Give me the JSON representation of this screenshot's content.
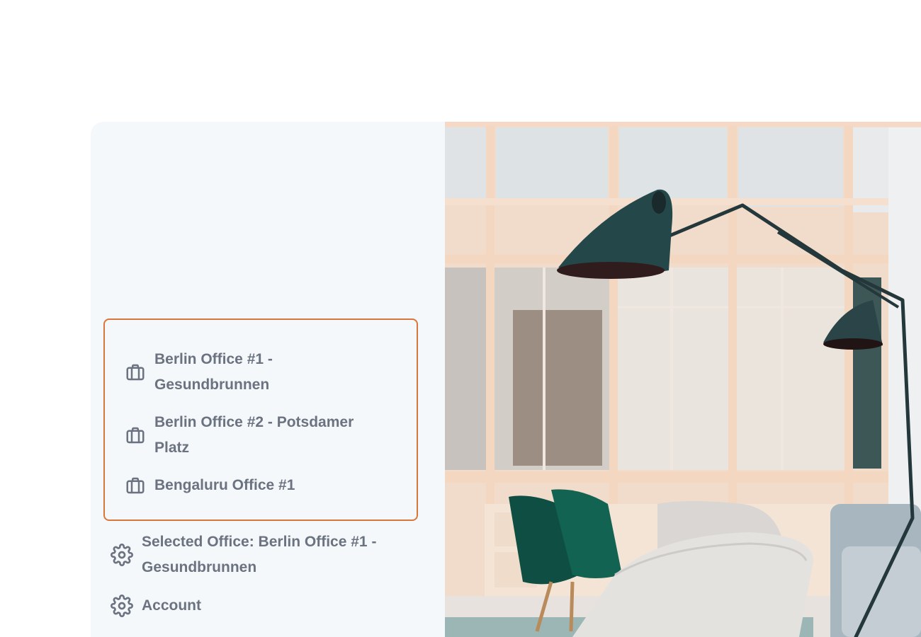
{
  "offices": [
    {
      "label": "Berlin Office #1 - Gesundbrunnen",
      "icon": "briefcase-icon"
    },
    {
      "label": "Berlin Office #2 - Potsdamer Platz",
      "icon": "briefcase-icon"
    },
    {
      "label": "Bengaluru Office #1",
      "icon": "briefcase-icon"
    }
  ],
  "menu": {
    "selected_office": {
      "label": "Selected Office: Berlin Office #1 - Gesundbrunnen",
      "icon": "gear-icon"
    },
    "account": {
      "label": "Account",
      "icon": "gear-icon"
    }
  },
  "colors": {
    "highlight_border": "#d9773a",
    "text": "#6b7280",
    "sidebar_bg": "#f5f8fb"
  }
}
